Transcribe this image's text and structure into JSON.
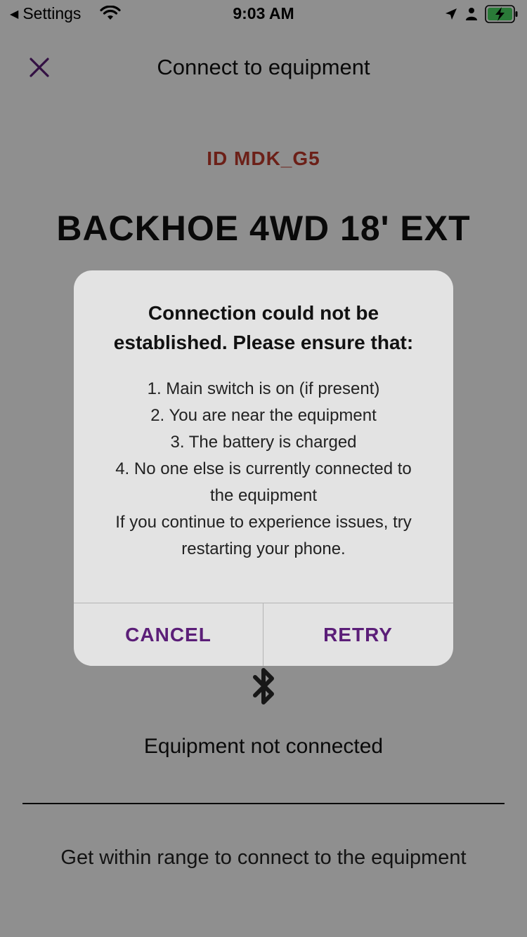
{
  "status_bar": {
    "back_label": "Settings",
    "time": "9:03 AM",
    "icons": [
      "back-triangle-icon",
      "wifi-icon",
      "location-arrow-icon",
      "person-icon",
      "battery-charging-icon"
    ],
    "battery_color": "#4cd964"
  },
  "header": {
    "close_icon": "close-icon",
    "title": "Connect to equipment"
  },
  "equipment": {
    "id": "ID MDK_G5",
    "name": "BACKHOE 4WD 18' EXT",
    "status_icon": "bluetooth-icon",
    "status": "Equipment not connected",
    "hint": "Get within range to connect to the equipment"
  },
  "alert": {
    "title_line1": "Connection could not be",
    "title_line2": "established. Please ensure that:",
    "body": [
      "1. Main switch is on (if present)",
      "2. You are near the equipment",
      "3. The battery is charged",
      "4. No one else is currently connected to",
      "the equipment",
      "If you continue to experience issues, try",
      "restarting your phone."
    ],
    "cancel_label": "CANCEL",
    "retry_label": "RETRY"
  },
  "colors": {
    "accent": "#5b1e78",
    "id_red": "#c0392b",
    "overlay": "rgba(0,0,0,0.44)"
  }
}
